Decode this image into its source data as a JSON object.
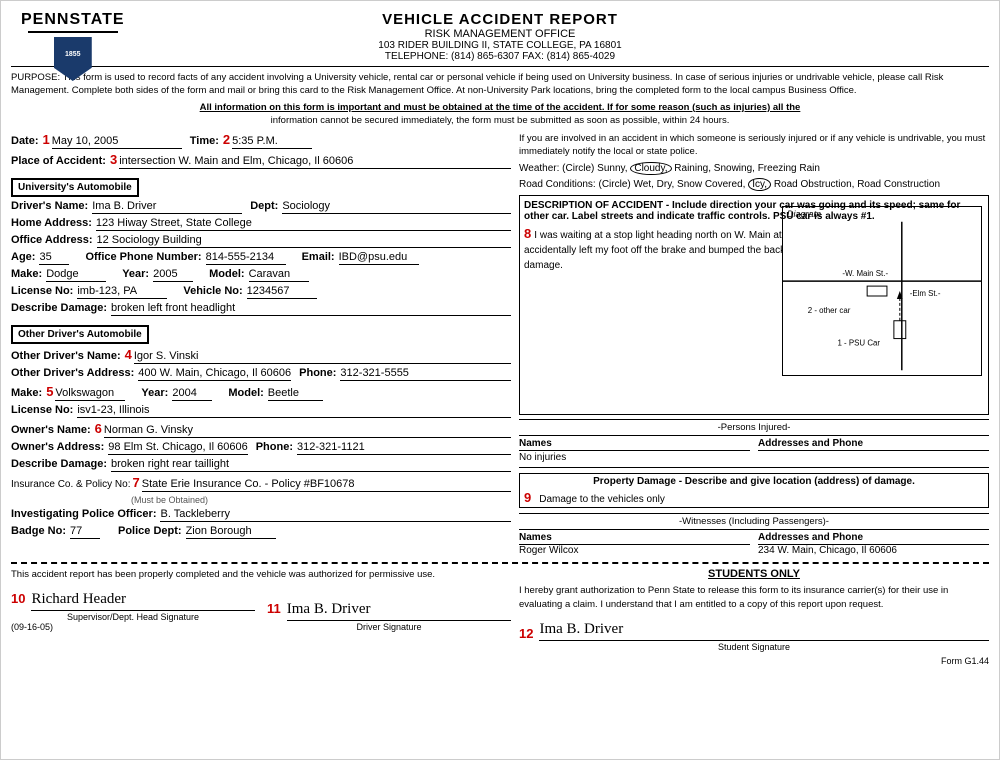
{
  "header": {
    "title": "VEHICLE ACCIDENT REPORT",
    "office": "RISK  MANAGEMENT  OFFICE",
    "address": "103 RIDER BUILDING II, STATE COLLEGE, PA  16801",
    "telephone": "TELEPHONE:  (814)  865-6307  FAX:  (814)  865-4029",
    "logo_text": "PENNSTATE",
    "logo_year": "1855"
  },
  "purpose": {
    "text": "PURPOSE:  This form is used to record facts of any accident involving a University vehicle, rental car or personal vehicle if being used on University business.  In case of serious injuries or undrivable vehicle, please call Risk Management.  Complete both sides of the form and mail or bring this card to the Risk Management Office.  At non-University Park locations, bring the completed form to the local campus Business Office.",
    "important1": "All information on this form is important and must be obtained at the time of the accident.  If for some reason (such as injuries) all the",
    "important2": "information cannot be secured immediately, the form must be submitted as soon as possible, within 24 hours."
  },
  "fields": {
    "date_label": "Date:",
    "date_num": "1",
    "date_val": "May 10, 2005",
    "time_label": "Time:",
    "time_num": "2",
    "time_val": "5:35 P.M.",
    "place_label": "Place of Accident:",
    "place_num": "3",
    "place_val": "intersection W. Main and Elm, Chicago, Il 60606"
  },
  "university_auto": {
    "section_label": "University's Automobile",
    "driver_name_label": "Driver's Name:",
    "driver_name": "Ima B. Driver",
    "dept_label": "Dept:",
    "dept": "Sociology",
    "home_address_label": "Home Address:",
    "home_address": "123 Hiway Street, State College",
    "office_address_label": "Office Address:",
    "office_address": "12 Sociology Building",
    "age_label": "Age:",
    "age": "35",
    "phone_label": "Office Phone Number:",
    "phone": "814-555-2134",
    "email_label": "Email:",
    "email": "IBD@psu.edu",
    "make_label": "Make:",
    "make": "Dodge",
    "year_label": "Year:",
    "year": "2005",
    "model_label": "Model:",
    "model": "Caravan",
    "license_label": "License No:",
    "license": "imb-123, PA",
    "vehicle_label": "Vehicle No:",
    "vehicle": "1234567",
    "damage_label": "Describe Damage:",
    "damage": "broken left front headlight"
  },
  "other_driver": {
    "section_label": "Other Driver's Automobile",
    "name_label": "Other Driver's Name:",
    "name_num": "4",
    "name": "Igor S. Vinski",
    "address_label": "Other Driver's Address:",
    "address": "400 W. Main, Chicago, Il 60606",
    "phone_label": "Phone:",
    "phone": "312-321-5555",
    "make_label": "Make:",
    "make_num": "5",
    "make": "Volkswagon",
    "year_label": "Year:",
    "year": "2004",
    "model_label": "Model:",
    "model": "Beetle",
    "license_label": "License No:",
    "license": "isv1-23, Illinois",
    "owner_name_label": "Owner's Name:",
    "owner_name_num": "6",
    "owner_name": "Norman G. Vinsky",
    "owner_address_label": "Owner's Address:",
    "owner_address": "98 Elm St. Chicago, Il 60606",
    "owner_phone_label": "Phone:",
    "owner_phone": "312-321-1121",
    "damage_label": "Describe Damage:",
    "damage": "broken right rear taillight",
    "insurance_label": "Insurance Co. & Policy No:",
    "insurance_note": "(Must be Obtained)",
    "insurance_num": "7",
    "insurance": "State Erie Insurance Co. - Policy #BF10678",
    "officer_label": "Investigating Police Officer:",
    "officer": "B. Tackleberry",
    "badge_label": "Badge No:",
    "badge": "77",
    "police_dept_label": "Police Dept:",
    "police_dept": "Zion Borough"
  },
  "right_col": {
    "notice_text": "If you are involved in an accident in which someone is seriously injured or if any vehicle is undrivable, you must immediately notify the local or state police.",
    "weather_label": "Weather: (Circle)",
    "weather_sunny": "Sunny,",
    "weather_cloudy": "Cloudy,",
    "weather_raining": "Raining,",
    "weather_snowing": "Snowing,",
    "weather_freezing": "Freezing Rain",
    "road_label": "Road Conditions: (Circle)",
    "road_wet": "Wet,",
    "road_dry": "Dry,",
    "road_snow": "Snow Covered,",
    "road_icy": "Icy,",
    "road_obstruction": "Road Obstruction,",
    "road_construction": "Road Construction",
    "desc_title": "DESCRIPTION OF ACCIDENT - Include direction your car was going and its speed; same for other car.  Label streets and indicate traffic controls.  PSU car is always #1.",
    "desc_num": "8",
    "desc_text": "I was waiting at a stop light heading north on W. Main at the intersection of W. Main and Elm. I accidentally left my foot off the brake and bumped the back of the other driver's car causing the damage.",
    "diagram_label": "Diagram",
    "road_main": "-W. Main St.-",
    "road_elm": "-Elm St.-",
    "car1": "1 - PSU Car",
    "car2": "2 - other car",
    "persons_header": "-Persons Injured-",
    "names_label": "Names",
    "names_value": "No injuries",
    "addresses_label": "Addresses and Phone",
    "property_label": "Property Damage - Describe and give location (address) of damage.",
    "property_num": "9",
    "property_value": "Damage to the vehicles only",
    "witnesses_header": "-Witnesses  (Including Passengers)-",
    "wit_names_label": "Names",
    "wit_address_label": "Addresses and Phone",
    "wit_name1": "Roger Wilcox",
    "wit_address1": "234 W. Main, Chicago, Il 60606"
  },
  "footer": {
    "footer_text": "This accident report has been properly completed and the vehicle was authorized for permissive use.",
    "sig1_num": "10",
    "sig1_cursive": "Richard Header",
    "sig1_label": "Supervisor/Dept. Head Signature",
    "sig2_num": "11",
    "sig2_cursive": "Ima B. Driver",
    "sig2_label": "Driver  Signature",
    "date_code": "(09-16-05)",
    "students_header": "STUDENTS ONLY",
    "students_text": "I hereby grant authorization to Penn State to release this form to its insurance carrier(s) for their use in evaluating a claim. I understand that I am entitled to a copy of this report upon request.",
    "sig3_num": "12",
    "sig3_cursive": "Ima B. Driver",
    "sig3_label": "Student  Signature",
    "form_id": "Form G1.44"
  }
}
